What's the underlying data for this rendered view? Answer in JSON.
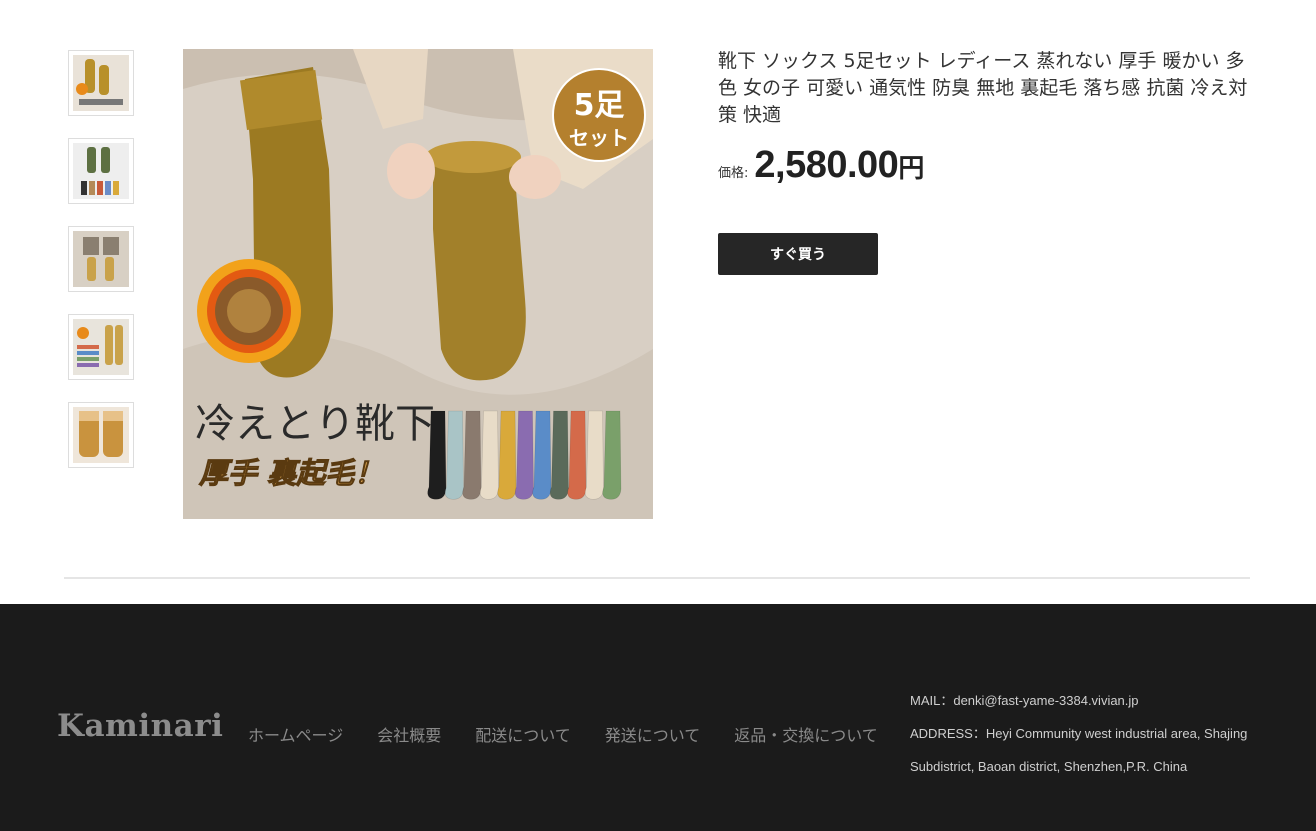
{
  "product": {
    "title": "靴下 ソックス 5足セット レディース 蒸れない 厚手 暖かい 多色 女の子 可愛い 通気性 防臭 無地 裏起毛 落ち感 抗菌 冷え対策 快適",
    "price_label": "価格:",
    "price_value": "2,580.00",
    "price_unit": "円",
    "buy_label": "すぐ買う"
  },
  "main_image": {
    "badge_line1": "5足",
    "badge_line2": "セット",
    "caption_main": "冷えとり靴下",
    "caption_sub": "厚手 裏起毛！",
    "sock_colors": [
      "#1e1e1e",
      "#a9c4c6",
      "#8a7a6e",
      "#e8dcc8",
      "#d9a93a",
      "#8a6cb0",
      "#5a8cc8",
      "#5a6a5a",
      "#d46a4a",
      "#e8dcc8",
      "#7aa06a"
    ]
  },
  "thumbnails": [
    {
      "name": "mustard-socks-thumbnail"
    },
    {
      "name": "green-socks-thumbnail"
    },
    {
      "name": "grey-socks-thumbnail"
    },
    {
      "name": "multicolor-socks-thumbnail"
    },
    {
      "name": "fleece-socks-thumbnail"
    }
  ],
  "footer": {
    "brand": "Kaminari",
    "nav": [
      "ホームページ",
      "会社概要",
      "配送について",
      "発送について",
      "返品・交換について"
    ],
    "mail": "MAIL：denki@fast-yame-3384.vivian.jp",
    "address_line1": "ADDRESS：Heyi Community west industrial area, Shajing",
    "address_line2": "Subdistrict, Baoan district, Shenzhen,P.R. China"
  }
}
